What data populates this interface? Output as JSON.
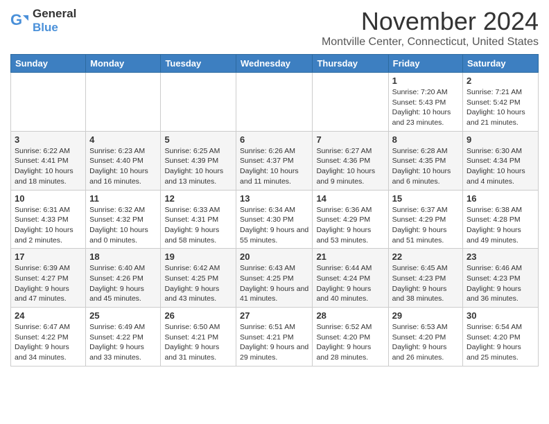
{
  "header": {
    "logo_general": "General",
    "logo_blue": "Blue",
    "month": "November 2024",
    "location": "Montville Center, Connecticut, United States"
  },
  "days_of_week": [
    "Sunday",
    "Monday",
    "Tuesday",
    "Wednesday",
    "Thursday",
    "Friday",
    "Saturday"
  ],
  "weeks": [
    [
      {
        "day": "",
        "info": ""
      },
      {
        "day": "",
        "info": ""
      },
      {
        "day": "",
        "info": ""
      },
      {
        "day": "",
        "info": ""
      },
      {
        "day": "",
        "info": ""
      },
      {
        "day": "1",
        "info": "Sunrise: 7:20 AM\nSunset: 5:43 PM\nDaylight: 10 hours and 23 minutes."
      },
      {
        "day": "2",
        "info": "Sunrise: 7:21 AM\nSunset: 5:42 PM\nDaylight: 10 hours and 21 minutes."
      }
    ],
    [
      {
        "day": "3",
        "info": "Sunrise: 6:22 AM\nSunset: 4:41 PM\nDaylight: 10 hours and 18 minutes."
      },
      {
        "day": "4",
        "info": "Sunrise: 6:23 AM\nSunset: 4:40 PM\nDaylight: 10 hours and 16 minutes."
      },
      {
        "day": "5",
        "info": "Sunrise: 6:25 AM\nSunset: 4:39 PM\nDaylight: 10 hours and 13 minutes."
      },
      {
        "day": "6",
        "info": "Sunrise: 6:26 AM\nSunset: 4:37 PM\nDaylight: 10 hours and 11 minutes."
      },
      {
        "day": "7",
        "info": "Sunrise: 6:27 AM\nSunset: 4:36 PM\nDaylight: 10 hours and 9 minutes."
      },
      {
        "day": "8",
        "info": "Sunrise: 6:28 AM\nSunset: 4:35 PM\nDaylight: 10 hours and 6 minutes."
      },
      {
        "day": "9",
        "info": "Sunrise: 6:30 AM\nSunset: 4:34 PM\nDaylight: 10 hours and 4 minutes."
      }
    ],
    [
      {
        "day": "10",
        "info": "Sunrise: 6:31 AM\nSunset: 4:33 PM\nDaylight: 10 hours and 2 minutes."
      },
      {
        "day": "11",
        "info": "Sunrise: 6:32 AM\nSunset: 4:32 PM\nDaylight: 10 hours and 0 minutes."
      },
      {
        "day": "12",
        "info": "Sunrise: 6:33 AM\nSunset: 4:31 PM\nDaylight: 9 hours and 58 minutes."
      },
      {
        "day": "13",
        "info": "Sunrise: 6:34 AM\nSunset: 4:30 PM\nDaylight: 9 hours and 55 minutes."
      },
      {
        "day": "14",
        "info": "Sunrise: 6:36 AM\nSunset: 4:29 PM\nDaylight: 9 hours and 53 minutes."
      },
      {
        "day": "15",
        "info": "Sunrise: 6:37 AM\nSunset: 4:29 PM\nDaylight: 9 hours and 51 minutes."
      },
      {
        "day": "16",
        "info": "Sunrise: 6:38 AM\nSunset: 4:28 PM\nDaylight: 9 hours and 49 minutes."
      }
    ],
    [
      {
        "day": "17",
        "info": "Sunrise: 6:39 AM\nSunset: 4:27 PM\nDaylight: 9 hours and 47 minutes."
      },
      {
        "day": "18",
        "info": "Sunrise: 6:40 AM\nSunset: 4:26 PM\nDaylight: 9 hours and 45 minutes."
      },
      {
        "day": "19",
        "info": "Sunrise: 6:42 AM\nSunset: 4:25 PM\nDaylight: 9 hours and 43 minutes."
      },
      {
        "day": "20",
        "info": "Sunrise: 6:43 AM\nSunset: 4:25 PM\nDaylight: 9 hours and 41 minutes."
      },
      {
        "day": "21",
        "info": "Sunrise: 6:44 AM\nSunset: 4:24 PM\nDaylight: 9 hours and 40 minutes."
      },
      {
        "day": "22",
        "info": "Sunrise: 6:45 AM\nSunset: 4:23 PM\nDaylight: 9 hours and 38 minutes."
      },
      {
        "day": "23",
        "info": "Sunrise: 6:46 AM\nSunset: 4:23 PM\nDaylight: 9 hours and 36 minutes."
      }
    ],
    [
      {
        "day": "24",
        "info": "Sunrise: 6:47 AM\nSunset: 4:22 PM\nDaylight: 9 hours and 34 minutes."
      },
      {
        "day": "25",
        "info": "Sunrise: 6:49 AM\nSunset: 4:22 PM\nDaylight: 9 hours and 33 minutes."
      },
      {
        "day": "26",
        "info": "Sunrise: 6:50 AM\nSunset: 4:21 PM\nDaylight: 9 hours and 31 minutes."
      },
      {
        "day": "27",
        "info": "Sunrise: 6:51 AM\nSunset: 4:21 PM\nDaylight: 9 hours and 29 minutes."
      },
      {
        "day": "28",
        "info": "Sunrise: 6:52 AM\nSunset: 4:20 PM\nDaylight: 9 hours and 28 minutes."
      },
      {
        "day": "29",
        "info": "Sunrise: 6:53 AM\nSunset: 4:20 PM\nDaylight: 9 hours and 26 minutes."
      },
      {
        "day": "30",
        "info": "Sunrise: 6:54 AM\nSunset: 4:20 PM\nDaylight: 9 hours and 25 minutes."
      }
    ]
  ]
}
